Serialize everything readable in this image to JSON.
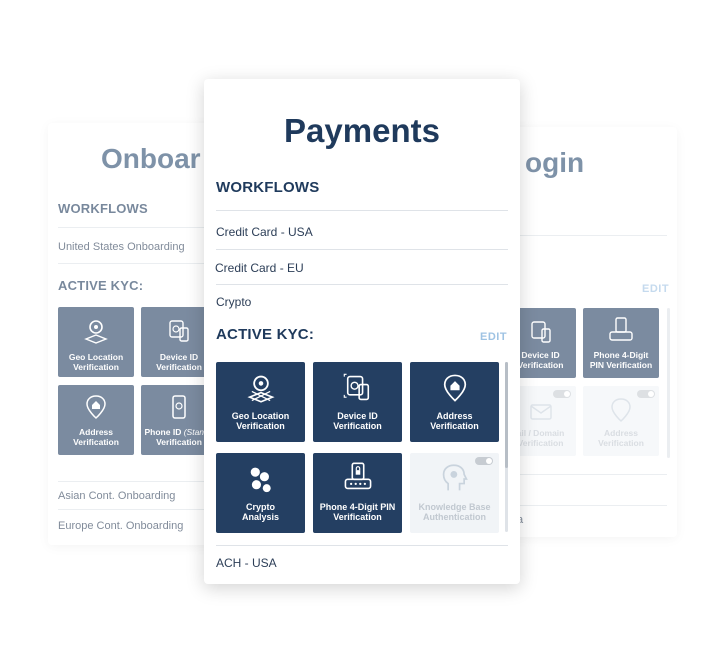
{
  "left_card": {
    "title": "Onboar",
    "workflows_heading": "WORKFLOWS",
    "first_workflow": "United States Onboarding",
    "kyc_heading": "ACTIVE KYC:",
    "tiles": [
      {
        "label": "Geo Location Verification",
        "icon": "geo-location-icon"
      },
      {
        "label": "Device ID Verification",
        "icon": "device-id-icon"
      },
      {
        "label": "Address Verification",
        "icon": "address-icon"
      },
      {
        "label_main": "Phone ID",
        "label_italic": "(Standa",
        "label_line2": "Verification",
        "icon": "phone-id-icon"
      }
    ],
    "more_workflows": [
      "Asian Cont. Onboarding",
      "Europe Cont. Onboarding"
    ]
  },
  "right_card": {
    "title": "ogin",
    "edit_label": "EDIT",
    "tiles": [
      {
        "label": "Device ID Verification",
        "icon": "device-id-icon"
      },
      {
        "label": "Phone 4-Digit PIN Verification",
        "icon": "pin-lock-icon"
      },
      {
        "label": "ail / Domain Verification",
        "icon": "email-icon"
      },
      {
        "label": "Address Verification",
        "icon": "address-icon"
      }
    ],
    "tail_text": "a"
  },
  "front_card": {
    "title": "Payments",
    "workflows_heading": "WORKFLOWS",
    "workflows": [
      "Credit Card - USA",
      "Credit Card - EU",
      "Crypto"
    ],
    "kyc_heading": "ACTIVE KYC:",
    "edit_label": "EDIT",
    "tiles": [
      {
        "label": "Geo Location Verification",
        "icon": "geo-location-icon",
        "enabled": true
      },
      {
        "label": "Device ID Verification",
        "icon": "device-id-icon",
        "enabled": true
      },
      {
        "label": "Address Verification",
        "icon": "address-icon",
        "enabled": true
      },
      {
        "label": "Crypto Analysis",
        "icon": "crypto-icon",
        "enabled": true
      },
      {
        "label": "Phone 4-Digit PIN Verification",
        "icon": "pin-lock-icon",
        "enabled": true
      },
      {
        "label": "Knowledge Base Authentication",
        "icon": "knowledge-head-icon",
        "enabled": false
      }
    ],
    "last_workflow": "ACH - USA"
  },
  "colors": {
    "tile": "#243f62",
    "heading": "#1f3a5c",
    "edit": "#9fc3e3",
    "disabled_tile": "#f1f4f7"
  }
}
